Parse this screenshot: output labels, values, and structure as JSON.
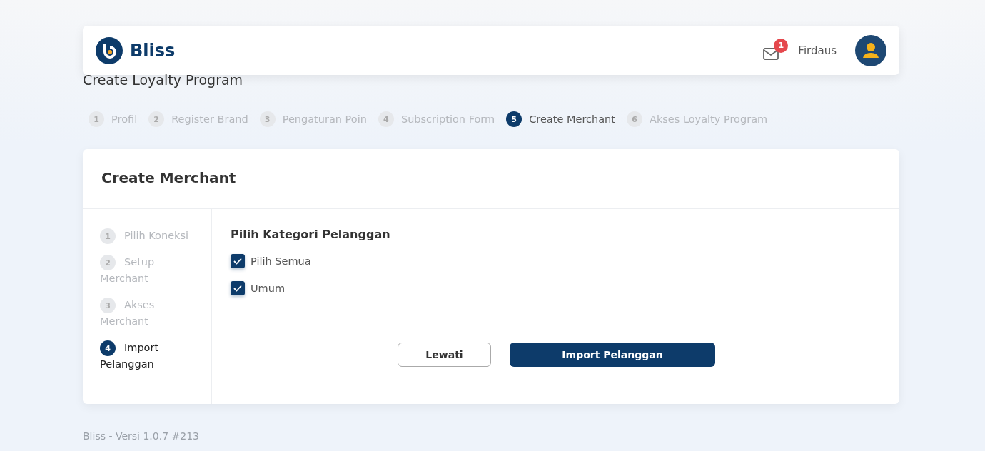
{
  "header": {
    "brand": "Bliss",
    "notifications": "1",
    "user": "Firdaus"
  },
  "page_title": "Create Loyalty Program",
  "steps": [
    {
      "number": "1",
      "label": "Profil",
      "selected": false
    },
    {
      "number": "2",
      "label": "Register Brand",
      "selected": false
    },
    {
      "number": "3",
      "label": "Pengaturan Poin",
      "selected": false
    },
    {
      "number": "4",
      "label": "Subscription Form",
      "selected": false
    },
    {
      "number": "5",
      "label": "Create Merchant",
      "selected": true
    },
    {
      "number": "6",
      "label": "Akses Loyalty Program",
      "selected": false
    }
  ],
  "card": {
    "title": "Create Merchant",
    "substeps": [
      {
        "number": "1",
        "label": "Pilih Koneksi",
        "selected": false
      },
      {
        "number": "2",
        "label": "Setup Merchant",
        "selected": false
      },
      {
        "number": "3",
        "label": "Akses Merchant",
        "selected": false
      },
      {
        "number": "4",
        "label": "Import Pelanggan",
        "selected": true
      }
    ],
    "section_title": "Pilih Kategori Pelanggan",
    "options": [
      {
        "label": "Pilih Semua",
        "checked": true
      },
      {
        "label": "Umum",
        "checked": true
      }
    ],
    "buttons": [
      {
        "label": "Lewati",
        "kind": "secondary"
      },
      {
        "label": "Import Pelanggan",
        "kind": "primary"
      }
    ]
  },
  "footer": "Bliss - Versi 1.0.7 #213"
}
